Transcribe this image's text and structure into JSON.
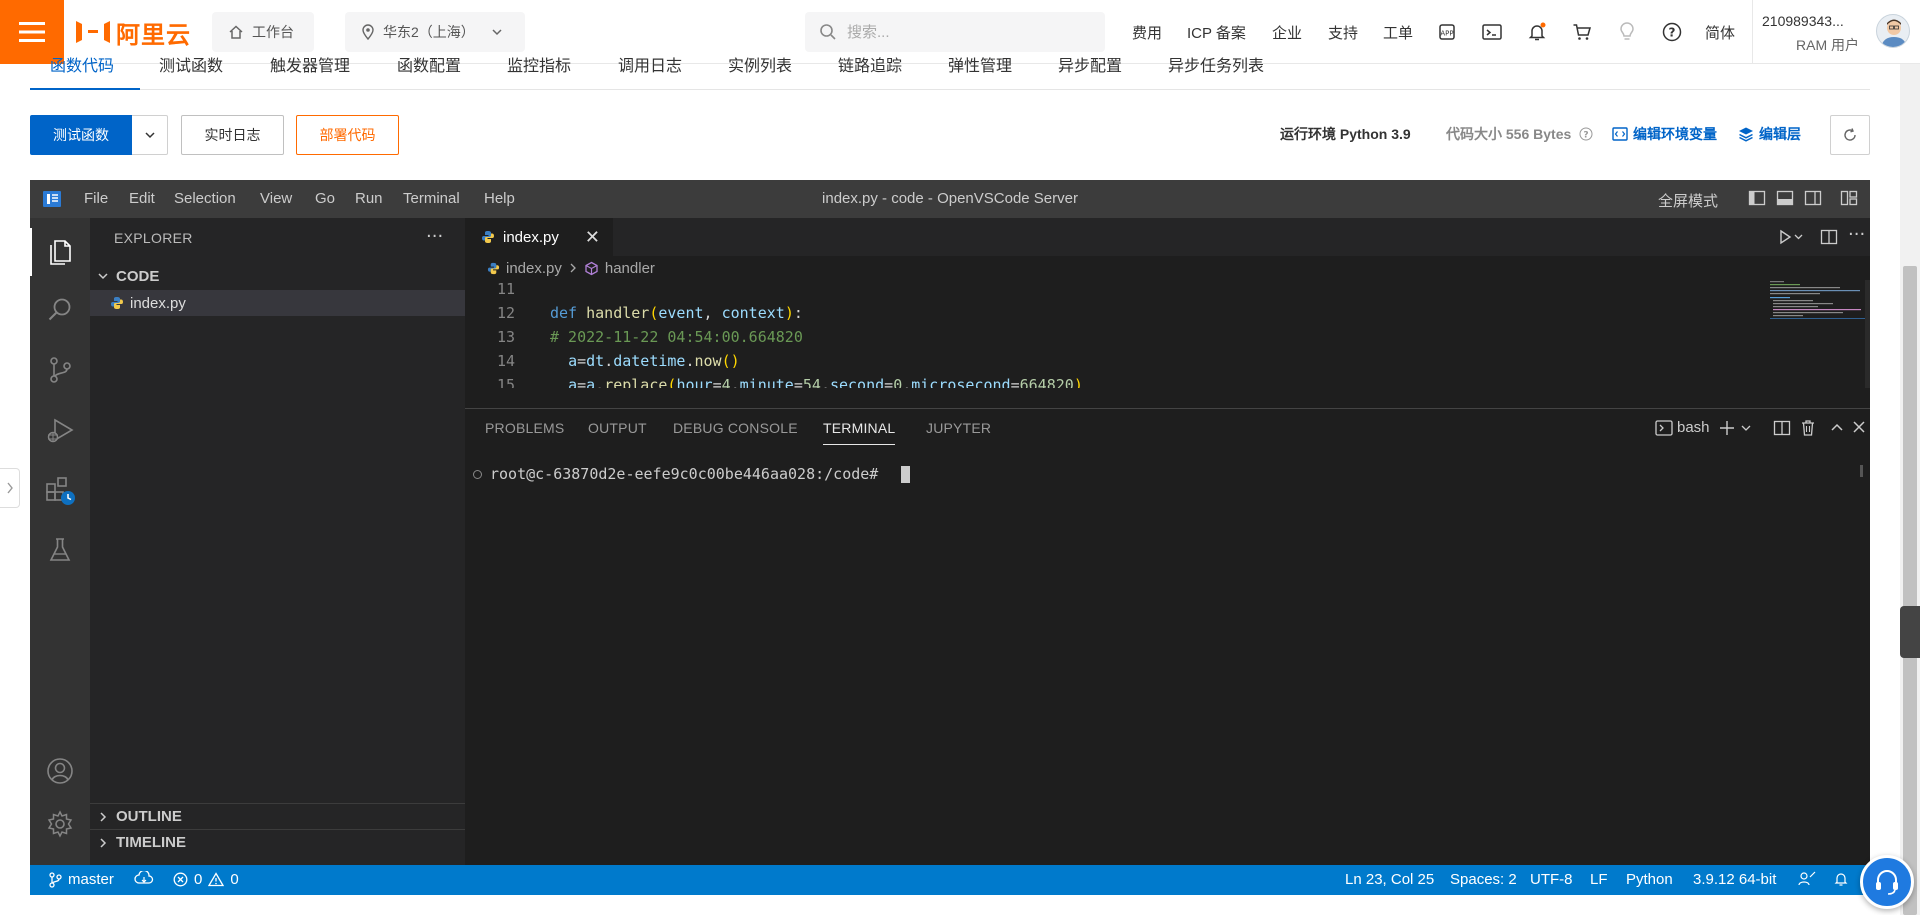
{
  "topbar": {
    "logo_text": "阿里云",
    "workbench_label": "工作台",
    "region_label": "华东2（上海）",
    "search_placeholder": "搜索...",
    "links": [
      "费用",
      "ICP 备案",
      "企业",
      "支持",
      "工单"
    ],
    "lang_label": "简体",
    "user_id": "210989343...",
    "user_role": "RAM 用户",
    "icons": [
      "app-icon",
      "terminal-icon",
      "bell-icon",
      "cart-icon",
      "bulb-icon",
      "help-icon"
    ],
    "brand_color": "#ff6a00"
  },
  "page_tabs": {
    "items": [
      "函数代码",
      "测试函数",
      "触发器管理",
      "函数配置",
      "监控指标",
      "调用日志",
      "实例列表",
      "链路追踪",
      "弹性管理",
      "异步配置",
      "异步任务列表"
    ],
    "active_index": 0
  },
  "toolbar": {
    "test_label": "测试函数",
    "logs_label": "实时日志",
    "deploy_label": "部署代码",
    "runtime_label": "运行环境 Python 3.9",
    "code_size_label": "代码大小 556 Bytes",
    "env_vars_label": "编辑环境变量",
    "layers_label": "编辑层"
  },
  "vscode": {
    "menu": [
      "File",
      "Edit",
      "Selection",
      "View",
      "Go",
      "Run",
      "Terminal",
      "Help"
    ],
    "window_title": "index.py - code - OpenVSCode Server",
    "fullscreen_label": "全屏模式",
    "explorer_title": "EXPLORER",
    "folder_name": "CODE",
    "file_name": "index.py",
    "outline_label": "OUTLINE",
    "timeline_label": "TIMELINE",
    "editor_tab": "index.py",
    "breadcrumb": {
      "file": "index.py",
      "symbol": "handler"
    },
    "code_lines": [
      {
        "n": "11",
        "text": ""
      },
      {
        "n": "12",
        "text": "def handler(event, context):"
      },
      {
        "n": "13",
        "text": "# 2022-11-22 04:54:00.664820"
      },
      {
        "n": "14",
        "text": "  a=dt.datetime.now()"
      },
      {
        "n": "15",
        "text": "  a=a.replace(hour=4,minute=54,second=0,microsecond=664820)"
      }
    ],
    "panel_tabs": [
      "PROBLEMS",
      "OUTPUT",
      "DEBUG CONSOLE",
      "TERMINAL",
      "JUPYTER"
    ],
    "active_panel_tab": "TERMINAL",
    "terminal_shell": "bash",
    "terminal_prompt": "root@c-63870d2e-eefe9c0c00be446aa028:/code# ",
    "status": {
      "branch": "master",
      "errors": "0",
      "warnings": "0",
      "position": "Ln 23, Col 25",
      "spaces": "Spaces: 2",
      "encoding": "UTF-8",
      "eol": "LF",
      "language": "Python",
      "interpreter": "3.9.12 64-bit"
    },
    "status_color": "#007acc"
  }
}
